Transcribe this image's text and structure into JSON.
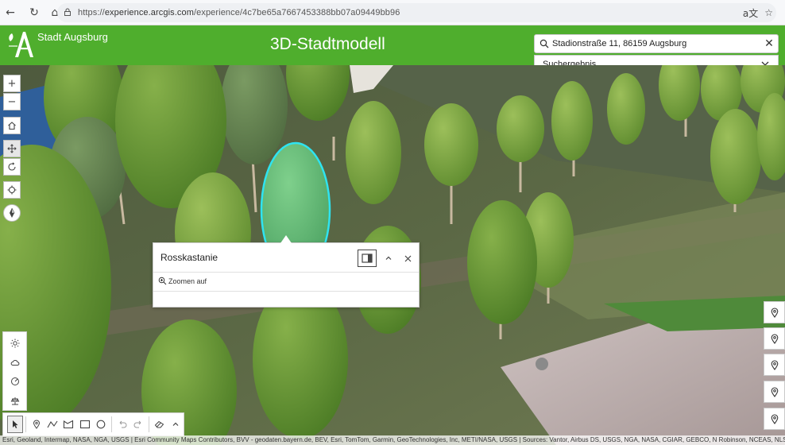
{
  "browser": {
    "url_scheme": "https://",
    "url_host": "experience.arcgis.com",
    "url_path": "/experience/4c7be65a7667453388bb07a09449bb96",
    "back_icon": "arrow-left-icon",
    "reload_icon": "reload-icon",
    "home_icon": "home-icon",
    "lock_icon": "lock-icon",
    "translate_icon": "translate-icon",
    "favorite_icon": "star-icon"
  },
  "header": {
    "brand": "Stadt Augsburg",
    "title": "3D-Stadtmodell",
    "bg_color": "#4fae2d"
  },
  "search": {
    "value": "Stadionstraße 11, 86159 Augsburg",
    "result_label": "Suchergebnis"
  },
  "map_tools": {
    "zoom_in": "+",
    "zoom_out": "−"
  },
  "popup": {
    "title": "Rosskastanie",
    "zoom_label": "Zoomen auf"
  },
  "attribution": "Esri, Geoland, Intermap, NASA, NGA, USGS | Esri Community Maps Contributors, BVV - geodaten.bayern.de, BEV, Esri, TomTom, Garmin, GeoTechnologies, Inc, METI/NASA, USGS | Sources: Vantor, Airbus DS, USGS, NGA, NASA, CGIAR, GEBCO, N Robinson, NCEAS, NLS, OS, NMA, Geodatastyrelsen, GSA, GSI and the GIS User Community"
}
